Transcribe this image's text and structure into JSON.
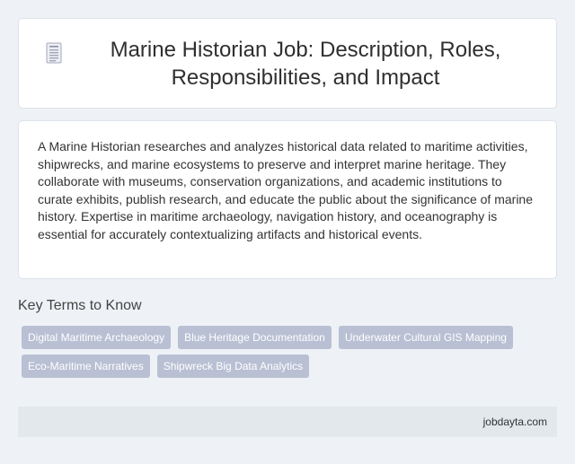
{
  "header": {
    "title": "Marine Historian Job: Description, Roles, Responsibilities, and Impact",
    "icon": "document-icon"
  },
  "description": {
    "text": "A Marine Historian researches and analyzes historical data related to maritime activities, shipwrecks, and marine ecosystems to preserve and interpret marine heritage. They collaborate with museums, conservation organizations, and academic institutions to curate exhibits, publish research, and educate the public about the significance of marine history. Expertise in maritime archaeology, navigation history, and oceanography is essential for accurately contextualizing artifacts and historical events."
  },
  "key_terms": {
    "heading": "Key Terms to Know",
    "tags": [
      "Digital Maritime Archaeology",
      "Blue Heritage Documentation",
      "Underwater Cultural GIS Mapping",
      "Eco-Maritime Narratives",
      "Shipwreck Big Data Analytics"
    ]
  },
  "footer": {
    "site": "jobdayta.com"
  },
  "colors": {
    "background": "#eef2f6",
    "card": "#ffffff",
    "tag": "#b9c0d4",
    "footer": "#e2e8ec"
  }
}
